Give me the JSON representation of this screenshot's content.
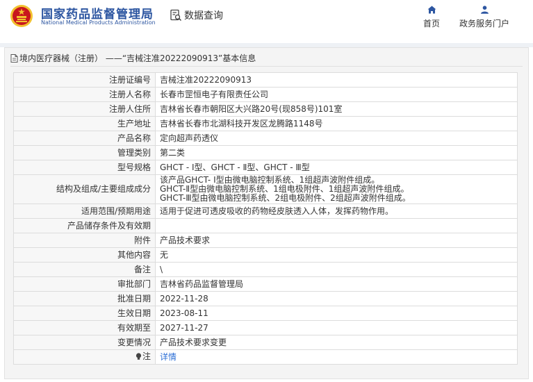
{
  "header": {
    "brand_cn": "国家药品监督管理局",
    "brand_en": "National Medical Products Administration",
    "query_label": "数据查询",
    "nav": {
      "home": "首页",
      "portal": "政务服务门户"
    }
  },
  "panel": {
    "title": "境内医疗器械（注册） ——“吉械注准20222090913”基本信息"
  },
  "rows": [
    {
      "label": "注册证编号",
      "value": "吉械注准20222090913"
    },
    {
      "label": "注册人名称",
      "value": "长春市罡恒电子有限责任公司"
    },
    {
      "label": "注册人住所",
      "value": "吉林省长春市朝阳区大兴路20号(现858号)101室"
    },
    {
      "label": "生产地址",
      "value": "吉林省长春市北湖科技开发区龙腾路1148号"
    },
    {
      "label": "产品名称",
      "value": "定向超声药透仪"
    },
    {
      "label": "管理类别",
      "value": "第二类"
    },
    {
      "label": "型号规格",
      "value": "GHCT - Ⅰ型、GHCT - Ⅱ型、GHCT - Ⅲ型"
    },
    {
      "label": "结构及组成/主要组成成分",
      "lines": [
        "该产品GHCT- Ⅰ型由微电脑控制系统、1组超声波附件组成。",
        "GHCT-Ⅱ型由微电脑控制系统、1组电极附件、1组超声波附件组成。",
        "GHCT-Ⅲ型由微电脑控制系统、2组电极附件、2组超声波附件组成。"
      ]
    },
    {
      "label": "适用范围/预期用途",
      "value": "适用于促进可透皮吸收的药物经皮肤透入人体，发挥药物作用。"
    },
    {
      "label": "产品储存条件及有效期",
      "value": ""
    },
    {
      "label": "附件",
      "value": "产品技术要求"
    },
    {
      "label": "其他内容",
      "value": "无"
    },
    {
      "label": "备注",
      "value": "\\"
    },
    {
      "label": "审批部门",
      "value": "吉林省药品监督管理局"
    },
    {
      "label": "批准日期",
      "value": "2022-11-28"
    },
    {
      "label": "生效日期",
      "value": "2023-08-11"
    },
    {
      "label": "有效期至",
      "value": "2027-11-27"
    },
    {
      "label": "变更情况",
      "value": "产品技术要求变更"
    },
    {
      "label": "注",
      "value": "详情"
    }
  ],
  "colors": {
    "brand": "#2d56a1",
    "link": "#2d6fd6",
    "emblem_red": "#c8161d",
    "emblem_gold": "#f2c230"
  },
  "icons": {
    "logo": "national-emblem",
    "query": "search-document-icon",
    "home": "home-icon",
    "portal": "user-icon",
    "panel": "document-icon",
    "note": "lightbulb-icon"
  }
}
